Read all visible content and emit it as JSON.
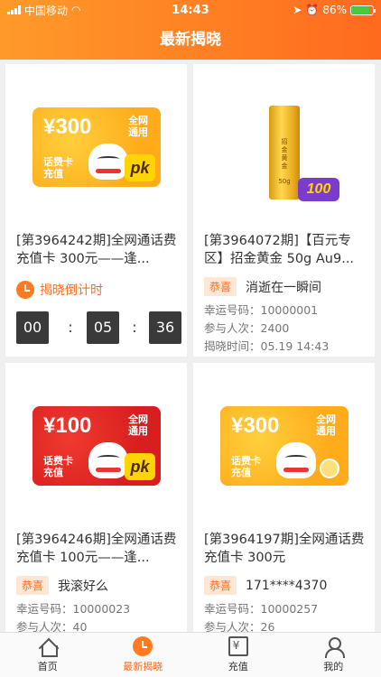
{
  "status": {
    "carrier": "中国移动",
    "time": "14:43",
    "battery": "86%",
    "battery_level": 0.86
  },
  "navbar": {
    "title": "最新揭晓"
  },
  "cards": [
    {
      "thumb": {
        "amount": "¥300",
        "net_line1": "全网",
        "net_line2": "通用",
        "tag_line1": "话费卡",
        "tag_line2": "充值",
        "badge": "pk"
      },
      "title": "[第3964242期]全网通话费充值卡 300元——逢...",
      "countdown_label": "揭晓倒计时",
      "timer": [
        "00",
        "05",
        "36"
      ]
    },
    {
      "thumb": {
        "bar_text": "招金黄金",
        "weight": "50g",
        "badge": "100"
      },
      "title": "[第3964072期]【百元专区】招金黄金 50g Au9...",
      "badge": "恭喜",
      "winner": "消逝在一瞬间",
      "lucky_label": "幸运号码：",
      "lucky_value": "10000001",
      "count_label": "参与人次：",
      "count_value": "2400",
      "time_label": "揭晓时间：",
      "time_value": "05.19 14:43"
    },
    {
      "thumb": {
        "amount": "¥100",
        "net_line1": "全网",
        "net_line2": "通用",
        "tag_line1": "话费卡",
        "tag_line2": "充值",
        "badge": "pk"
      },
      "title": "[第3964246期]全网通话费充值卡 100元——逢...",
      "badge": "恭喜",
      "winner": "我滚好么",
      "lucky_label": "幸运号码：",
      "lucky_value": "10000023",
      "count_label": "参与人次：",
      "count_value": "40"
    },
    {
      "thumb": {
        "amount": "¥300",
        "net_line1": "全网",
        "net_line2": "通用",
        "tag_line1": "话费卡",
        "tag_line2": "充值"
      },
      "title": "[第3964197期]全网通话费充值卡 300元",
      "badge": "恭喜",
      "winner": "171****4370",
      "lucky_label": "幸运号码：",
      "lucky_value": "10000257",
      "count_label": "参与人次：",
      "count_value": "26"
    }
  ],
  "tabs": [
    {
      "label": "首页",
      "icon": "home-icon"
    },
    {
      "label": "最新揭晓",
      "icon": "alarm-clock-icon",
      "active": true
    },
    {
      "label": "充值",
      "icon": "recharge-icon"
    },
    {
      "label": "我的",
      "icon": "user-icon"
    }
  ],
  "colors": {
    "accent": "#ff6a1e",
    "accent_light": "#ff9a2a"
  }
}
